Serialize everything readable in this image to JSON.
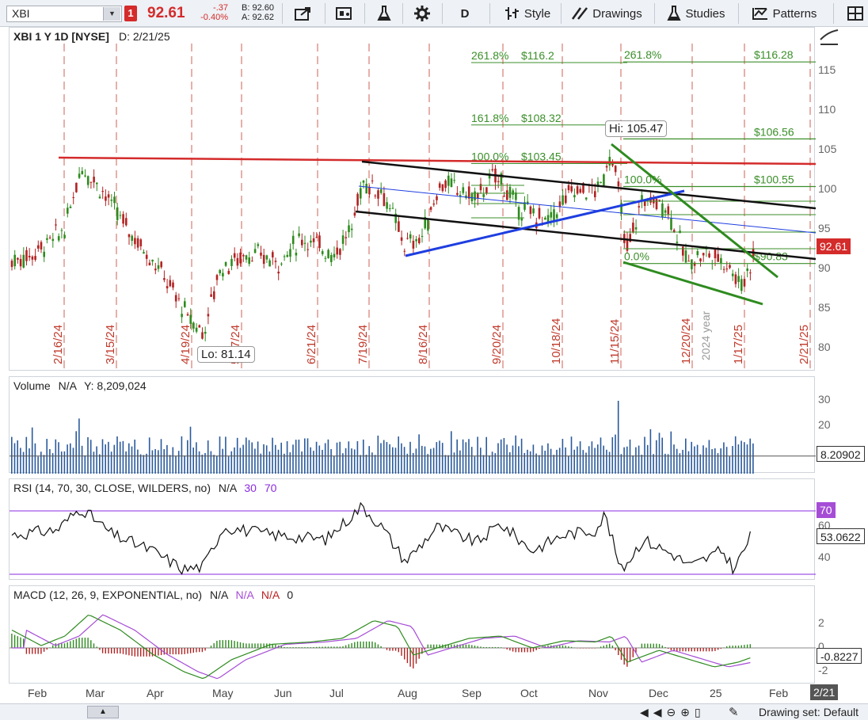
{
  "toolbar": {
    "symbol": "XBI",
    "flag": "1",
    "last_price": "92.61",
    "net_change": "-.37",
    "pct_change": "-0.40%",
    "bid": "B: 92.60",
    "ask": "A: 92.62",
    "timeframe": "D",
    "style_label": "Style",
    "drawings_label": "Drawings",
    "studies_label": "Studies",
    "patterns_label": "Patterns"
  },
  "chart_header": {
    "title": "XBI 1 Y 1D [NYSE]",
    "date": "D: 2/21/25"
  },
  "price_axis": [
    "115",
    "110",
    "105",
    "100",
    "95",
    "90",
    "85",
    "80"
  ],
  "price_tag": "92.61",
  "annotations": {
    "hi": "Hi: 105.47",
    "lo": "Lo: 81.14",
    "year_marker": "2024 year"
  },
  "fib_left": [
    {
      "pct": "261.8%",
      "price": "$116.2"
    },
    {
      "pct": "161.8%",
      "price": "$108.32"
    },
    {
      "pct": "100.0%",
      "price": "$103.45"
    }
  ],
  "fib_right": [
    {
      "pct": "261.8%",
      "price": "$116.28"
    },
    {
      "pct": "",
      "price": "$106.56"
    },
    {
      "pct": "100.0%",
      "price": "$100.55"
    },
    {
      "pct": "0.0%",
      "price": "$90.83"
    }
  ],
  "date_markers": [
    "2/16/24",
    "3/15/24",
    "4/19/24",
    "5/17/24",
    "6/21/24",
    "7/19/24",
    "8/16/24",
    "9/20/24",
    "10/18/24",
    "11/15/24",
    "12/20/24",
    "1/17/25",
    "2/21/25"
  ],
  "volume": {
    "label": "Volume",
    "na": "N/A",
    "y": "Y: 8,209,024",
    "axis": [
      "30",
      "20",
      "10"
    ],
    "tag": "8.20902"
  },
  "rsi": {
    "label": "RSI (14, 70, 30, CLOSE, WILDERS, no)",
    "na": "N/A",
    "v30": "30",
    "v70": "70",
    "axis": [
      "60",
      "40"
    ],
    "tag70": "70",
    "tag": "53.0622"
  },
  "macd": {
    "label": "MACD (12, 26, 9, EXPONENTIAL, no)",
    "na1": "N/A",
    "na2": "N/A",
    "na3": "N/A",
    "zero": "0",
    "axis": [
      "2",
      "0",
      "-2"
    ],
    "tag": "-0.8227"
  },
  "months": [
    "Feb",
    "Mar",
    "Apr",
    "May",
    "Jun",
    "Jul",
    "Aug",
    "Sep",
    "Oct",
    "Nov",
    "Dec",
    "25",
    "Feb"
  ],
  "date_tag": "2/21",
  "bottom": {
    "drawing_set": "Drawing set: Default"
  },
  "colors": {
    "red": "#d42b2b",
    "green": "#2e8b1f",
    "blue": "#1e3ee0",
    "black": "#111111",
    "fib_green": "#3b8f2a",
    "volume": "#2a5a9c",
    "macd_purple": "#a64dd6"
  }
}
